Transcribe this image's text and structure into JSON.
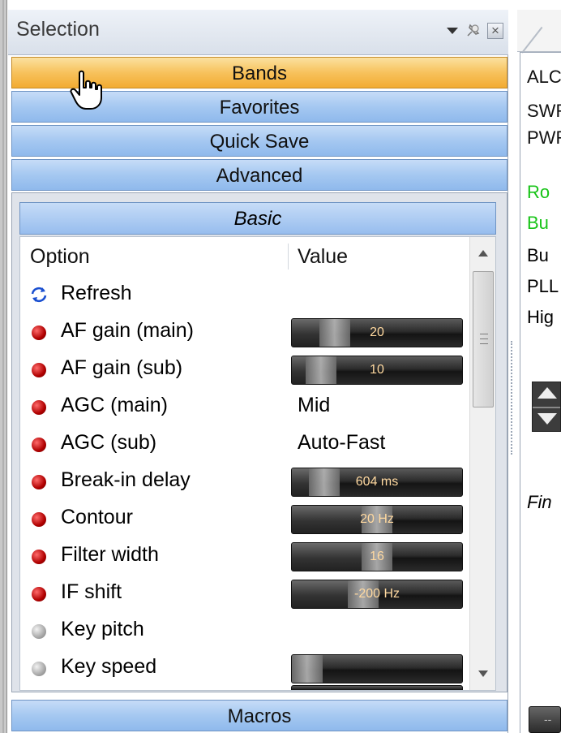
{
  "panel": {
    "title": "Selection",
    "groups": {
      "bands": "Bands",
      "favorites": "Favorites",
      "quick_save": "Quick Save",
      "advanced": "Advanced",
      "macros": "Macros"
    },
    "active_group": "Bands",
    "section_title": "Basic",
    "columns": {
      "option": "Option",
      "value": "Value"
    },
    "rows": [
      {
        "label": "Refresh",
        "icon": "refresh-icon"
      },
      {
        "label": "AF gain (main)",
        "icon": "red-dot",
        "slider_text": "20",
        "slider_level": 0.2
      },
      {
        "label": "AF gain (sub)",
        "icon": "red-dot",
        "slider_text": "10",
        "slider_level": 0.1
      },
      {
        "label": "AGC (main)",
        "icon": "red-dot",
        "value": "Mid"
      },
      {
        "label": "AGC (sub)",
        "icon": "red-dot",
        "value": "Auto-Fast"
      },
      {
        "label": "Break-in delay",
        "icon": "red-dot",
        "slider_text": "604 ms",
        "slider_level": 0.12
      },
      {
        "label": "Contour",
        "icon": "red-dot",
        "slider_text": "20 Hz",
        "slider_level": 0.5
      },
      {
        "label": "Filter width",
        "icon": "red-dot",
        "slider_text": "16",
        "slider_level": 0.5
      },
      {
        "label": "IF shift",
        "icon": "red-dot",
        "slider_text": "-200 Hz",
        "slider_level": 0.4
      },
      {
        "label": "Key pitch",
        "icon": "gray-dot"
      },
      {
        "label": "Key speed",
        "icon": "gray-dot",
        "slider_level": 0.0
      }
    ]
  },
  "right_panel": {
    "meters": [
      "ALC",
      "SWR",
      "PWR"
    ],
    "status": [
      {
        "text": "Ro",
        "color": "#18c418"
      },
      {
        "text": "Bu",
        "color": "#18c418"
      },
      {
        "text": "Bu",
        "color": "#111111"
      },
      {
        "text": "PLL",
        "color": "#111111"
      },
      {
        "text": "Hig",
        "color": "#111111"
      }
    ],
    "fine_label": "Fin",
    "bottom_text": "--"
  },
  "colors": {
    "active_group": "#f7c25c",
    "group": "#a5c8f1",
    "status_green": "#18c418",
    "dot_red": "#b00000"
  }
}
